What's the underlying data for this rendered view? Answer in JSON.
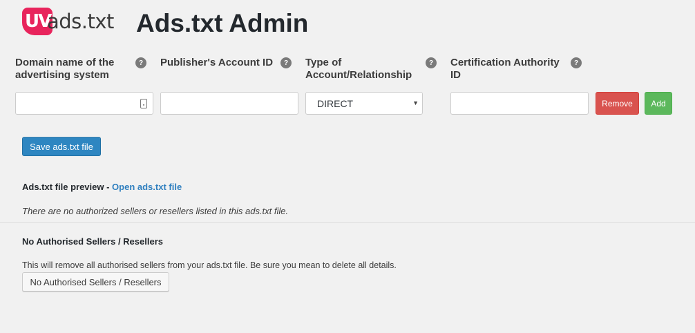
{
  "header": {
    "logo_badge": "UV",
    "logo_text": "ads.txt",
    "title": "Ads.txt Admin"
  },
  "columns": [
    {
      "label": "Domain name of the advertising system",
      "help": "?"
    },
    {
      "label": "Publisher's Account ID",
      "help": "?"
    },
    {
      "label": "Type of Account/Relationship",
      "help": "?"
    },
    {
      "label": "Certification Authority ID",
      "help": "?"
    }
  ],
  "row": {
    "domain_value": "",
    "publisher_value": "",
    "type_selected": "DIRECT",
    "cert_value": "",
    "remove_label": "Remove",
    "add_label": "Add"
  },
  "actions": {
    "save_label": "Save ads.txt file"
  },
  "preview": {
    "heading": "Ads.txt file preview - ",
    "link_label": "Open ads.txt file",
    "empty_message": "There are no authorized sellers or resellers listed in this ads.txt file."
  },
  "no_sellers": {
    "heading": "No Authorised Sellers / Resellers",
    "description": "This will remove all authorised sellers from your ads.txt file. Be sure you mean to delete all details.",
    "button_label": "No Authorised Sellers / Resellers"
  },
  "colors": {
    "brand": "#e8245c",
    "primary": "#2e86c1",
    "danger": "#d9534f",
    "success": "#5cb85c",
    "link": "#2f7fbf"
  }
}
